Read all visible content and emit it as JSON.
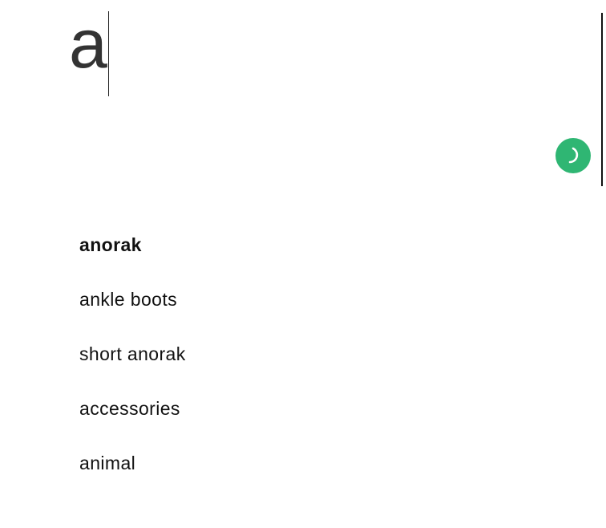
{
  "search": {
    "value": "a"
  },
  "spinner": {
    "icon": "loading-spinner-icon",
    "color": "#2fb673"
  },
  "suggestions": [
    {
      "label": "anorak",
      "highlighted": true
    },
    {
      "label": "ankle boots",
      "highlighted": false
    },
    {
      "label": "short anorak",
      "highlighted": false
    },
    {
      "label": "accessories",
      "highlighted": false
    },
    {
      "label": "animal",
      "highlighted": false
    }
  ]
}
